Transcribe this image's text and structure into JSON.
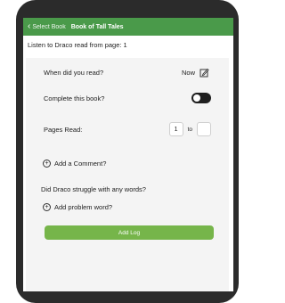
{
  "nav": {
    "back_label": "Select Book",
    "title": "Book of Tall Tales"
  },
  "header": {
    "text": "Listen to Draco  read from page: 1"
  },
  "form": {
    "when_label": "When did you read?",
    "when_value": "Now",
    "complete_label": "Complete this book?",
    "pages_label": "Pages Read:",
    "pages_from": "1",
    "pages_to_label": "to",
    "pages_to": "",
    "add_comment": "Add a Comment?",
    "struggle_question": "Did Draco  struggle with any words?",
    "add_problem_word": "Add problem word?",
    "submit_label": "Add Log"
  },
  "colors": {
    "nav_bg": "#4a9a4a",
    "submit_bg": "#76b54a",
    "device_frame": "#2b2b2b"
  }
}
